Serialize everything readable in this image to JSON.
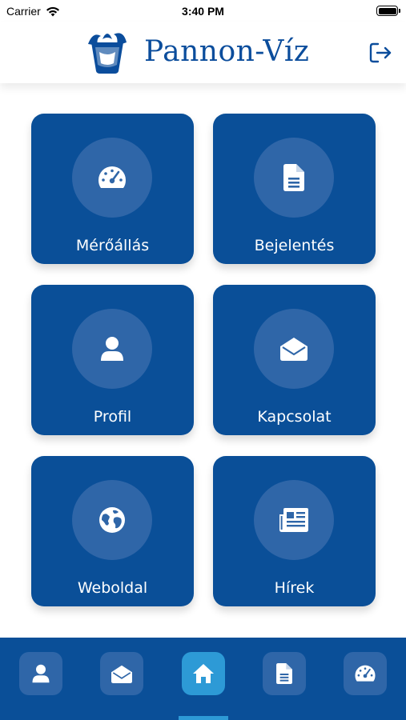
{
  "status_bar": {
    "carrier": "Carrier",
    "time": "3:40 PM"
  },
  "header": {
    "title": "Pannon-Víz",
    "logo_icon": "water-glass-icon",
    "logout_icon": "logout-icon"
  },
  "tiles": [
    {
      "label": "Mérőállás",
      "icon": "gauge-icon"
    },
    {
      "label": "Bejelentés",
      "icon": "document-icon"
    },
    {
      "label": "Profil",
      "icon": "user-icon"
    },
    {
      "label": "Kapcsolat",
      "icon": "envelope-open-icon"
    },
    {
      "label": "Weboldal",
      "icon": "globe-icon"
    },
    {
      "label": "Hírek",
      "icon": "newspaper-icon"
    }
  ],
  "bottom_nav": {
    "items": [
      {
        "icon": "user-icon",
        "active": false
      },
      {
        "icon": "envelope-open-icon",
        "active": false
      },
      {
        "icon": "home-icon",
        "active": true
      },
      {
        "icon": "document-icon",
        "active": false
      },
      {
        "icon": "gauge-icon",
        "active": false
      }
    ]
  },
  "colors": {
    "primary": "#0a4f98",
    "circle": "#2f66a8",
    "accent": "#2d9ad6"
  }
}
